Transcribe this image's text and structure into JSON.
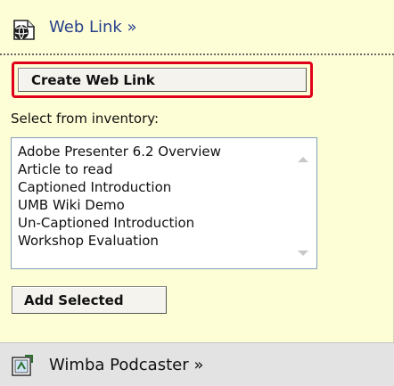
{
  "web_link_section": {
    "title": "Web Link »",
    "create_button_label": "Create Web Link",
    "inventory_label": "Select from inventory:",
    "inventory_items": [
      "Adobe Presenter 6.2 Overview",
      "Article to read",
      "Captioned Introduction",
      "UMB Wiki Demo",
      "Un-Captioned Introduction",
      "Workshop Evaluation"
    ],
    "add_button_label": "Add Selected"
  },
  "podcaster_section": {
    "title": "Wimba Podcaster »"
  },
  "colors": {
    "panel_background": "#fefed6",
    "highlight_border": "#e0001a",
    "link_title": "#27408b",
    "footer_background": "#e3e3e3"
  },
  "icons": {
    "web_link": "globe-link-icon",
    "podcaster": "podcaster-icon",
    "scroll_up": "scroll-up-arrow-icon",
    "scroll_down": "scroll-down-arrow-icon"
  }
}
